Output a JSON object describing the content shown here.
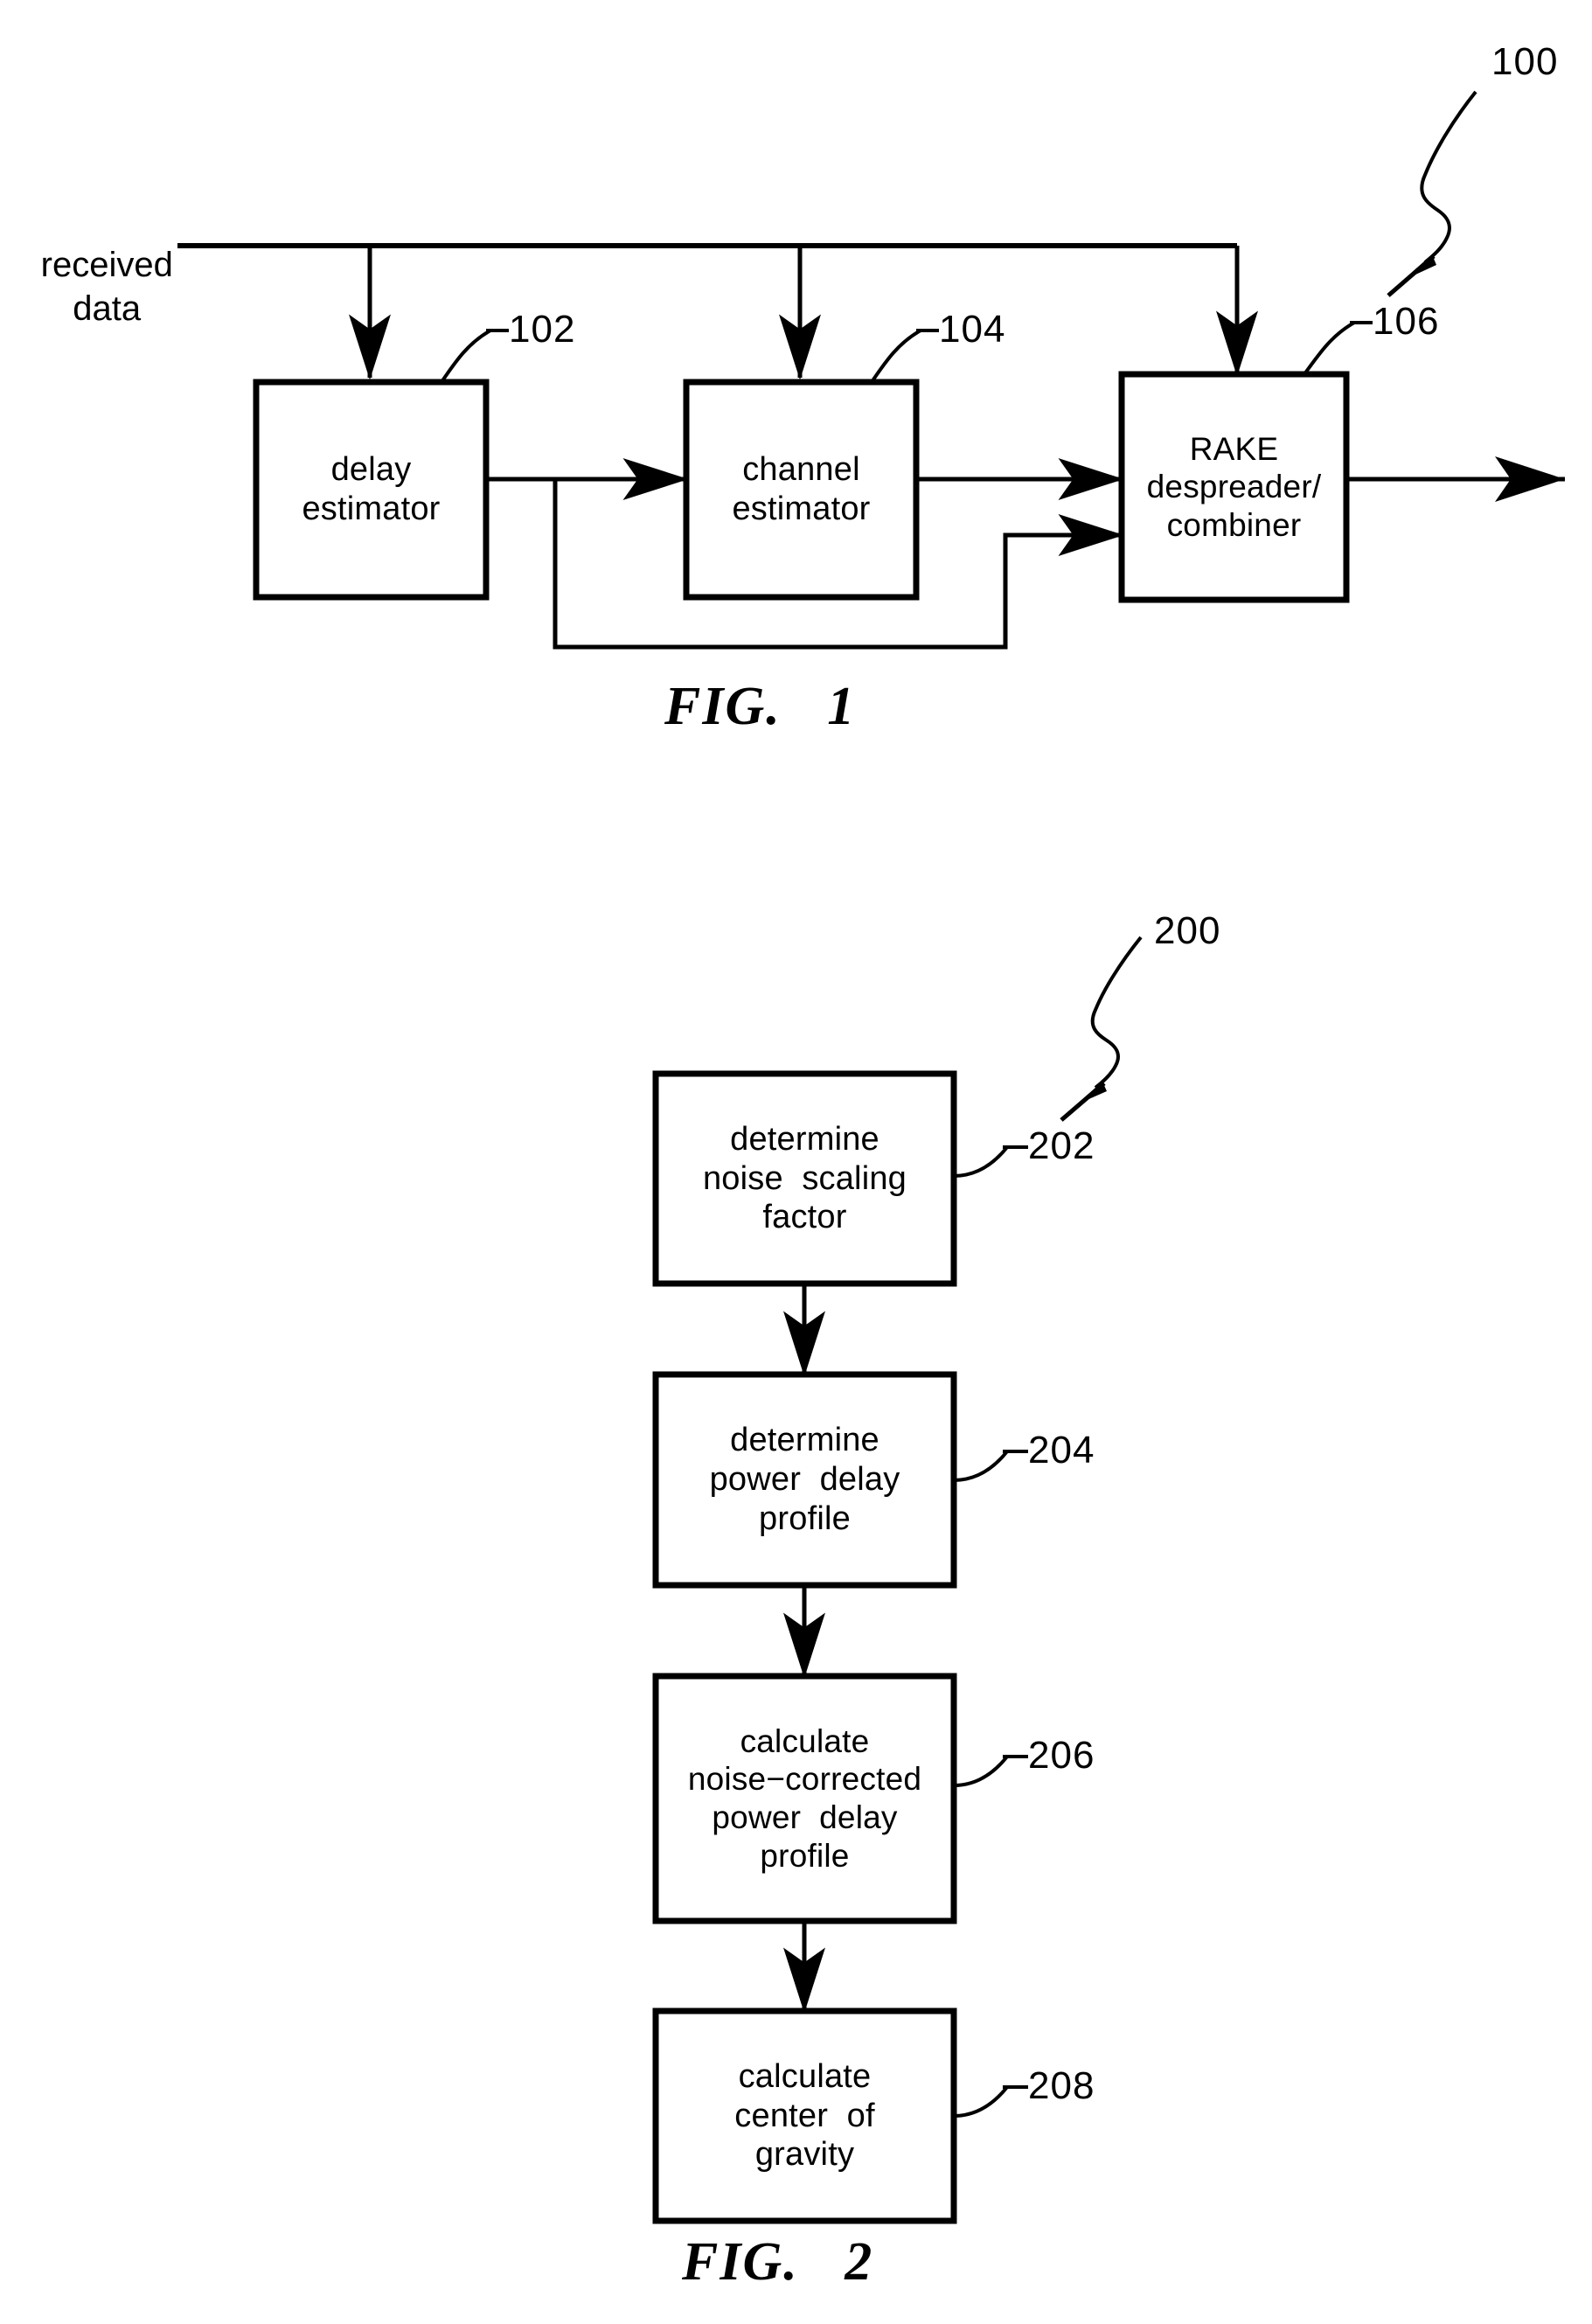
{
  "document": {
    "kind": "patent-drawing-sheet",
    "background_color": "#ffffff",
    "ink_color": "#000000"
  },
  "figures": [
    {
      "id": "fig1",
      "caption": "FIG.   1",
      "ref_numeral": "100",
      "input_label": "received\ndata",
      "input_label_line1": "received",
      "input_label_line2": "data",
      "blocks": [
        {
          "id": "block-102",
          "ref": "102",
          "lines": [
            "delay",
            "estimator"
          ]
        },
        {
          "id": "block-104",
          "ref": "104",
          "lines": [
            "channel",
            "estimator"
          ]
        },
        {
          "id": "block-106",
          "ref": "106",
          "lines": [
            "RAKE",
            "despreader/",
            "combiner"
          ]
        }
      ]
    },
    {
      "id": "fig2",
      "caption": "FIG.   2",
      "ref_numeral": "200",
      "blocks": [
        {
          "id": "block-202",
          "ref": "202",
          "lines": [
            "determine",
            "noise  scaling",
            "factor"
          ]
        },
        {
          "id": "block-204",
          "ref": "204",
          "lines": [
            "determine",
            "power  delay",
            "profile"
          ]
        },
        {
          "id": "block-206",
          "ref": "206",
          "lines": [
            "calculate",
            "noise−corrected",
            "power  delay",
            "profile"
          ]
        },
        {
          "id": "block-208",
          "ref": "208",
          "lines": [
            "calculate",
            "center  of",
            "gravity"
          ]
        }
      ]
    }
  ]
}
